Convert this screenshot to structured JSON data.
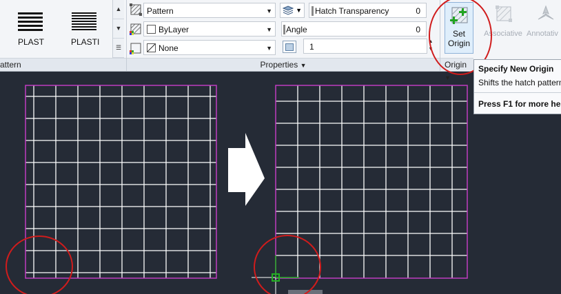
{
  "pattern_panel": {
    "items": [
      {
        "label": "PLAST"
      },
      {
        "label": "PLASTI"
      }
    ],
    "footer_label": "attern"
  },
  "properties_panel": {
    "pattern_type": "Pattern",
    "color": "ByLayer",
    "background": "None",
    "transparency": {
      "label": "Hatch Transparency",
      "value": "0"
    },
    "angle": {
      "label": "Angle",
      "value": "0"
    },
    "scale": {
      "value": "1"
    },
    "footer_label": "Properties"
  },
  "origin_panel": {
    "set_origin_line1": "Set",
    "set_origin_line2": "Origin",
    "footer_label": "Origin",
    "associative_label": "Associative",
    "annotative_label": "Annotativ"
  },
  "tooltip": {
    "title": "Specify New Origin",
    "description": "Shifts the hatch pattern",
    "help": "Press F1 for more he"
  },
  "colors": {
    "canvas": "#252b36",
    "boundary": "#c03cc0",
    "grid": "#ffffff",
    "annotation_circle": "#d01c1c",
    "origin_marker": "#21b021",
    "set_origin_plus": "#21a321"
  }
}
